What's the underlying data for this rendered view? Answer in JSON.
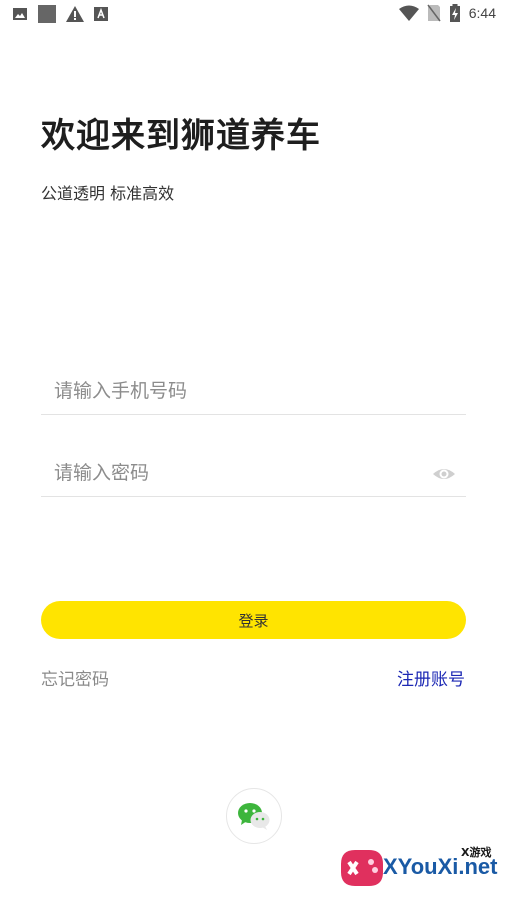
{
  "statusbar": {
    "time": "6:44",
    "left_icons": [
      "image-icon",
      "square-icon",
      "alert-icon",
      "a-box-icon"
    ],
    "right_icons": [
      "wifi-icon",
      "no-sim-icon",
      "battery-icon"
    ]
  },
  "welcome": {
    "title": "欢迎来到狮道养车",
    "subtitle": "公道透明 标准高效"
  },
  "form": {
    "phone_placeholder": "请输入手机号码",
    "password_placeholder": "请输入密码",
    "eye_icon": "eye-icon"
  },
  "actions": {
    "login_label": "登录",
    "forgot_label": "忘记密码",
    "register_label": "注册账号"
  },
  "social": {
    "wechat_icon": "wechat-icon"
  },
  "watermark": {
    "small_text": "X游戏",
    "site_text": "XYouXi.net"
  },
  "colors": {
    "accent": "#ffe400",
    "link": "#1c28b4",
    "wechat": "#3db53c"
  }
}
